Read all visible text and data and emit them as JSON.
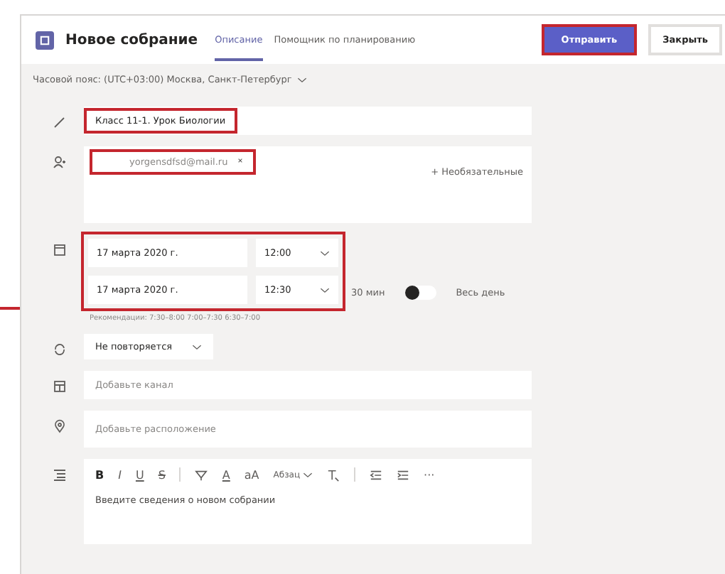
{
  "header": {
    "title": "Новое собрание",
    "tabs": [
      {
        "label": "Описание",
        "selected": true
      },
      {
        "label": "Помощник по планированию",
        "selected": false
      }
    ],
    "buttons": [
      {
        "kind": "primary",
        "label": "Отправить",
        "highlighted": true
      },
      {
        "kind": "secondary",
        "label": "Закрыть",
        "highlighted": false
      }
    ]
  },
  "timezone": {
    "label": "Часовой пояс: (UTC+03:00) Москва, Санкт-Петербург"
  },
  "title_field": {
    "value": "Класс 11-1. Урок Биологии",
    "highlighted": true
  },
  "attendees": {
    "chips": [
      {
        "label": "yorgensdfsd@mail.ru",
        "highlighted": true
      }
    ],
    "optional_link": "+ Необязательные"
  },
  "schedule": {
    "highlighted": true,
    "start": {
      "date": "17 марта 2020 г.",
      "time": "12:00"
    },
    "end": {
      "date": "17 марта 2020 г.",
      "time": "12:30"
    },
    "duration": "30 мин",
    "all_day": {
      "label": "Весь день",
      "on": false
    },
    "suggestions": "Рекомендации: 7:30–8:00  7:00–7:30  6:30–7:00"
  },
  "repeat": {
    "value": "Не повторяется"
  },
  "channel": {
    "placeholder": "Добавьте канал"
  },
  "location": {
    "placeholder": "Добавьте расположение"
  },
  "editor": {
    "toolbar": [
      {
        "kind": "bold",
        "label": "B"
      },
      {
        "kind": "italic",
        "label": "I"
      },
      {
        "kind": "underline",
        "label": "U"
      },
      {
        "kind": "strike",
        "label": "S"
      },
      {
        "kind": "divider"
      },
      {
        "kind": "highlight"
      },
      {
        "kind": "color",
        "label": "A"
      },
      {
        "kind": "size",
        "label": "aA"
      },
      {
        "kind": "paragraph",
        "label": "Абзац"
      },
      {
        "kind": "clear"
      },
      {
        "kind": "divider"
      },
      {
        "kind": "outdent"
      },
      {
        "kind": "indent"
      },
      {
        "kind": "more",
        "label": "···"
      }
    ],
    "placeholder": "Введите сведения о новом собрании"
  }
}
